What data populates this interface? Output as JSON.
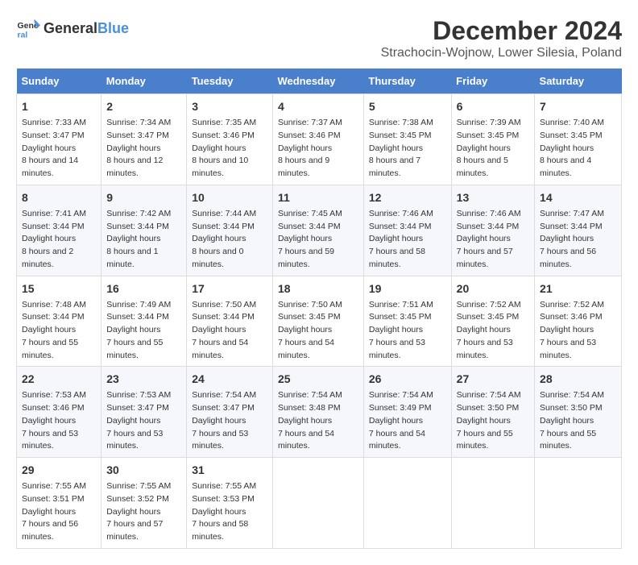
{
  "logo": {
    "general": "General",
    "blue": "Blue"
  },
  "title": "December 2024",
  "subtitle": "Strachocin-Wojnow, Lower Silesia, Poland",
  "days_of_week": [
    "Sunday",
    "Monday",
    "Tuesday",
    "Wednesday",
    "Thursday",
    "Friday",
    "Saturday"
  ],
  "weeks": [
    [
      {
        "day": "1",
        "sunrise": "7:33 AM",
        "sunset": "3:47 PM",
        "daylight": "8 hours and 14 minutes."
      },
      {
        "day": "2",
        "sunrise": "7:34 AM",
        "sunset": "3:47 PM",
        "daylight": "8 hours and 12 minutes."
      },
      {
        "day": "3",
        "sunrise": "7:35 AM",
        "sunset": "3:46 PM",
        "daylight": "8 hours and 10 minutes."
      },
      {
        "day": "4",
        "sunrise": "7:37 AM",
        "sunset": "3:46 PM",
        "daylight": "8 hours and 9 minutes."
      },
      {
        "day": "5",
        "sunrise": "7:38 AM",
        "sunset": "3:45 PM",
        "daylight": "8 hours and 7 minutes."
      },
      {
        "day": "6",
        "sunrise": "7:39 AM",
        "sunset": "3:45 PM",
        "daylight": "8 hours and 5 minutes."
      },
      {
        "day": "7",
        "sunrise": "7:40 AM",
        "sunset": "3:45 PM",
        "daylight": "8 hours and 4 minutes."
      }
    ],
    [
      {
        "day": "8",
        "sunrise": "7:41 AM",
        "sunset": "3:44 PM",
        "daylight": "8 hours and 2 minutes."
      },
      {
        "day": "9",
        "sunrise": "7:42 AM",
        "sunset": "3:44 PM",
        "daylight": "8 hours and 1 minute."
      },
      {
        "day": "10",
        "sunrise": "7:44 AM",
        "sunset": "3:44 PM",
        "daylight": "8 hours and 0 minutes."
      },
      {
        "day": "11",
        "sunrise": "7:45 AM",
        "sunset": "3:44 PM",
        "daylight": "7 hours and 59 minutes."
      },
      {
        "day": "12",
        "sunrise": "7:46 AM",
        "sunset": "3:44 PM",
        "daylight": "7 hours and 58 minutes."
      },
      {
        "day": "13",
        "sunrise": "7:46 AM",
        "sunset": "3:44 PM",
        "daylight": "7 hours and 57 minutes."
      },
      {
        "day": "14",
        "sunrise": "7:47 AM",
        "sunset": "3:44 PM",
        "daylight": "7 hours and 56 minutes."
      }
    ],
    [
      {
        "day": "15",
        "sunrise": "7:48 AM",
        "sunset": "3:44 PM",
        "daylight": "7 hours and 55 minutes."
      },
      {
        "day": "16",
        "sunrise": "7:49 AM",
        "sunset": "3:44 PM",
        "daylight": "7 hours and 55 minutes."
      },
      {
        "day": "17",
        "sunrise": "7:50 AM",
        "sunset": "3:44 PM",
        "daylight": "7 hours and 54 minutes."
      },
      {
        "day": "18",
        "sunrise": "7:50 AM",
        "sunset": "3:45 PM",
        "daylight": "7 hours and 54 minutes."
      },
      {
        "day": "19",
        "sunrise": "7:51 AM",
        "sunset": "3:45 PM",
        "daylight": "7 hours and 53 minutes."
      },
      {
        "day": "20",
        "sunrise": "7:52 AM",
        "sunset": "3:45 PM",
        "daylight": "7 hours and 53 minutes."
      },
      {
        "day": "21",
        "sunrise": "7:52 AM",
        "sunset": "3:46 PM",
        "daylight": "7 hours and 53 minutes."
      }
    ],
    [
      {
        "day": "22",
        "sunrise": "7:53 AM",
        "sunset": "3:46 PM",
        "daylight": "7 hours and 53 minutes."
      },
      {
        "day": "23",
        "sunrise": "7:53 AM",
        "sunset": "3:47 PM",
        "daylight": "7 hours and 53 minutes."
      },
      {
        "day": "24",
        "sunrise": "7:54 AM",
        "sunset": "3:47 PM",
        "daylight": "7 hours and 53 minutes."
      },
      {
        "day": "25",
        "sunrise": "7:54 AM",
        "sunset": "3:48 PM",
        "daylight": "7 hours and 54 minutes."
      },
      {
        "day": "26",
        "sunrise": "7:54 AM",
        "sunset": "3:49 PM",
        "daylight": "7 hours and 54 minutes."
      },
      {
        "day": "27",
        "sunrise": "7:54 AM",
        "sunset": "3:50 PM",
        "daylight": "7 hours and 55 minutes."
      },
      {
        "day": "28",
        "sunrise": "7:54 AM",
        "sunset": "3:50 PM",
        "daylight": "7 hours and 55 minutes."
      }
    ],
    [
      {
        "day": "29",
        "sunrise": "7:55 AM",
        "sunset": "3:51 PM",
        "daylight": "7 hours and 56 minutes."
      },
      {
        "day": "30",
        "sunrise": "7:55 AM",
        "sunset": "3:52 PM",
        "daylight": "7 hours and 57 minutes."
      },
      {
        "day": "31",
        "sunrise": "7:55 AM",
        "sunset": "3:53 PM",
        "daylight": "7 hours and 58 minutes."
      },
      null,
      null,
      null,
      null
    ]
  ]
}
